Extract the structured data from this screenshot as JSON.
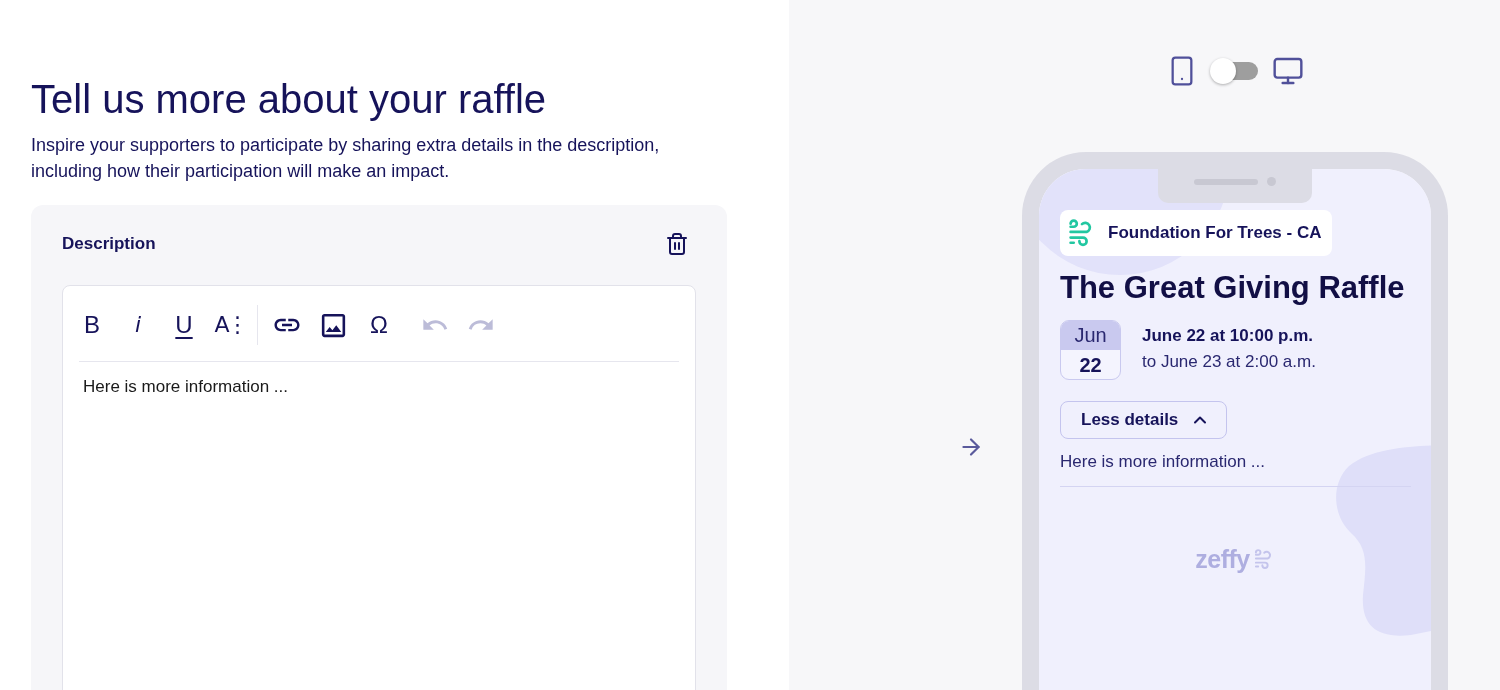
{
  "heading": {
    "title": "Tell us more about your raffle",
    "subtitle": "Inspire your supporters to participate by sharing extra details in the description, including how their participation will make an impact."
  },
  "description_card": {
    "label": "Description",
    "editor": {
      "toolbar_groups": [
        {
          "divider": true,
          "tools": [
            {
              "kind": "bold",
              "label": "B",
              "disabled": false
            },
            {
              "kind": "italic",
              "label": "i",
              "disabled": false
            },
            {
              "kind": "underline",
              "label": "U",
              "disabled": false
            },
            {
              "kind": "size",
              "label": "A⋮",
              "disabled": false
            }
          ]
        },
        {
          "divider": false,
          "tools": [
            {
              "kind": "link",
              "disabled": false
            },
            {
              "kind": "image",
              "disabled": false
            },
            {
              "kind": "symbol",
              "label": "Ω",
              "disabled": false
            }
          ]
        },
        {
          "divider": false,
          "tools": [
            {
              "kind": "undo",
              "disabled": true
            },
            {
              "kind": "redo",
              "disabled": true
            }
          ]
        }
      ],
      "value": "Here is more information ..."
    }
  },
  "preview_toggle": {
    "on": false
  },
  "preview": {
    "organization": "Foundation For Trees - CA",
    "title": "The Great Giving Raffle",
    "date_badge": {
      "month": "Jun",
      "day": "22"
    },
    "start": "June 22 at 10:00 p.m.",
    "end": "to June 23 at 2:00 a.m.",
    "details_button": {
      "label": "Less details",
      "expanded": true
    },
    "details": "Here is more information ...",
    "brand": "zeffy"
  }
}
